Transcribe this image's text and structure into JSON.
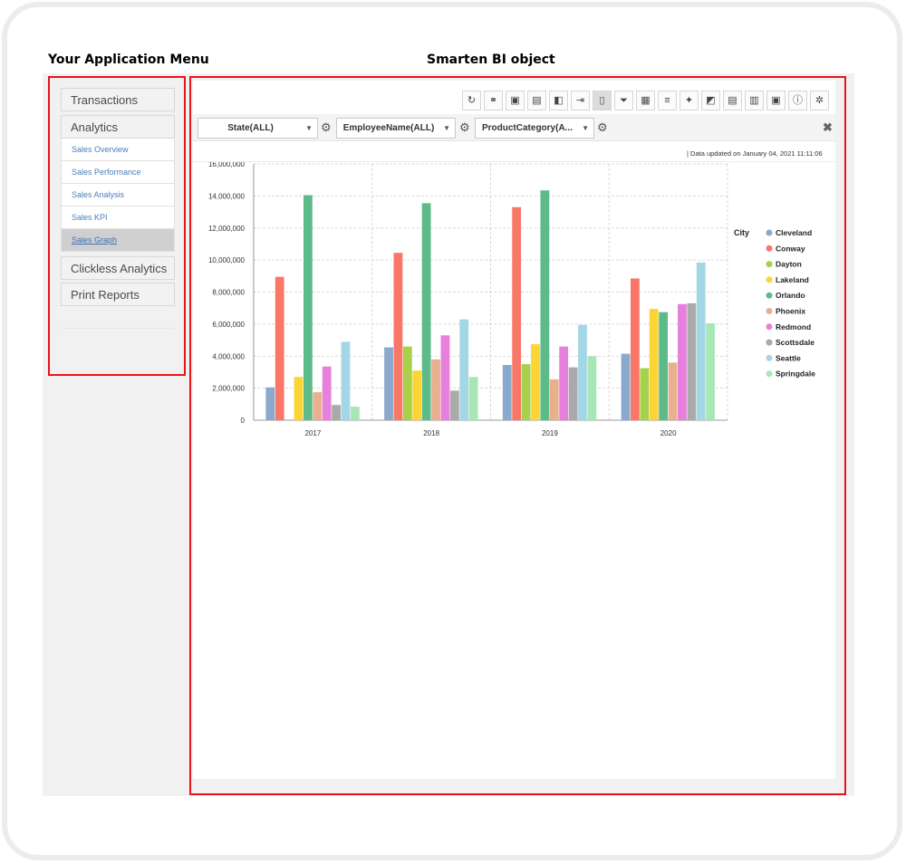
{
  "headings": {
    "app_menu": "Your Application Menu",
    "bi_object": "Smarten BI object"
  },
  "menu": {
    "top_items": [
      "Transactions",
      "Analytics"
    ],
    "sub_items": [
      "Sales Overview",
      "Sales Performance",
      "Sales Analysis",
      "Sales KPI",
      "Sales Graph"
    ],
    "active_sub": "Sales Graph",
    "bottom_items": [
      "Clickless Analytics",
      "Print Reports"
    ]
  },
  "toolbar": {
    "icons": [
      "refresh-icon",
      "link-icon",
      "save-icon",
      "save-as-icon",
      "broadcast-icon",
      "export-icon",
      "page-icon",
      "filter-icon",
      "grid-icon",
      "sort-icon",
      "magic-icon",
      "pointer-icon",
      "table-icon",
      "bar-chart-icon",
      "object-icon",
      "info-icon",
      "settings-icon"
    ],
    "glyphs": [
      "↻",
      "⚭",
      "▣",
      "▤",
      "◧",
      "⇥",
      "▯",
      "⏷",
      "▦",
      "≡",
      "✦",
      "◩",
      "▤",
      "▥",
      "▣",
      "ⓘ",
      "✲"
    ],
    "pressed_index": 6
  },
  "filters": [
    {
      "label": "State(ALL)"
    },
    {
      "label": "EmployeeName(ALL)"
    },
    {
      "label": "ProductCategory(A..."
    }
  ],
  "close_label": "✖",
  "updated": {
    "prefix": "|  Data updated on",
    "date": "January 04, 2021 11:11:06"
  },
  "chart_data": {
    "type": "bar",
    "categories": [
      "2017",
      "2018",
      "2019",
      "2020"
    ],
    "legend_title": "City",
    "legend_position": "right",
    "grid": true,
    "ylim": [
      0,
      16000000
    ],
    "yticks": [
      0,
      2000000,
      4000000,
      6000000,
      8000000,
      10000000,
      12000000,
      14000000,
      16000000
    ],
    "ytick_labels": [
      "0",
      "2,000,000",
      "4,000,000",
      "6,000,000",
      "8,000,000",
      "10,000,000",
      "12,000,000",
      "14,000,000",
      "16,000,000"
    ],
    "series": [
      {
        "name": "Cleveland",
        "color": "#8ba9cc",
        "values": [
          2050000,
          4550000,
          3450000,
          4150000
        ]
      },
      {
        "name": "Conway",
        "color": "#f87766",
        "values": [
          8950000,
          10450000,
          13300000,
          8850000
        ]
      },
      {
        "name": "Dayton",
        "color": "#a8d04a",
        "values": [
          0,
          4600000,
          3500000,
          3250000
        ]
      },
      {
        "name": "Lakeland",
        "color": "#fbd535",
        "values": [
          2700000,
          3100000,
          4750000,
          6950000
        ]
      },
      {
        "name": "Orlando",
        "color": "#5dbb8a",
        "values": [
          14050000,
          13550000,
          14350000,
          6750000
        ]
      },
      {
        "name": "Phoenix",
        "color": "#e8b08e",
        "values": [
          1750000,
          3800000,
          2550000,
          3600000
        ]
      },
      {
        "name": "Redmond",
        "color": "#e77fdc",
        "values": [
          3350000,
          5300000,
          4600000,
          7250000
        ]
      },
      {
        "name": "Scottsdale",
        "color": "#aaaaaa",
        "values": [
          950000,
          1850000,
          3300000,
          7300000
        ]
      },
      {
        "name": "Seattle",
        "color": "#a4d7e6",
        "values": [
          4900000,
          6300000,
          5950000,
          9850000
        ]
      },
      {
        "name": "Springdale",
        "color": "#a9e6b6",
        "values": [
          850000,
          2700000,
          4000000,
          6050000
        ]
      }
    ]
  }
}
